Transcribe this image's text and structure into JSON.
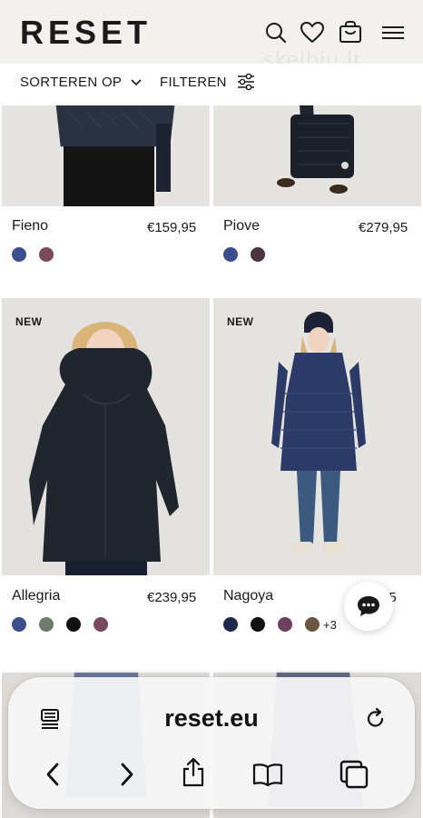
{
  "header": {
    "logo": "RESET",
    "watermark": "skelbiu.lt",
    "icons": [
      "search-icon",
      "heart-icon",
      "bag-icon",
      "menu-icon"
    ]
  },
  "toolbar": {
    "sort_label": "SORTEREN OP",
    "filter_label": "FILTEREN"
  },
  "products": [
    {
      "name": "Fieno",
      "price": "€159,95",
      "badge": "",
      "swatches": [
        "#3d4e8c",
        "#7a4a5c"
      ],
      "more": ""
    },
    {
      "name": "Piove",
      "price": "€279,95",
      "badge": "",
      "swatches": [
        "#3d4e8c",
        "#4a3440"
      ],
      "more": ""
    },
    {
      "name": "Allegria",
      "price": "€239,95",
      "badge": "NEW",
      "swatches": [
        "#3d4e8c",
        "#6c7b6e",
        "#111111",
        "#7a4a5c"
      ],
      "more": ""
    },
    {
      "name": "Nagoya",
      "price": "€...,95",
      "badge": "NEW",
      "swatches": [
        "#1f2a4a",
        "#111111",
        "#6e4060",
        "#6b5640"
      ],
      "more": "+3"
    }
  ],
  "browser": {
    "url": "reset.eu",
    "icons": [
      "reader-icon",
      "reload-icon",
      "back-icon",
      "forward-icon",
      "share-icon",
      "bookmarks-icon",
      "tabs-icon"
    ]
  },
  "colors": {
    "header_bg": "#f3f1ee",
    "image_bg": "#e3e1de",
    "text": "#1a1a1a"
  }
}
